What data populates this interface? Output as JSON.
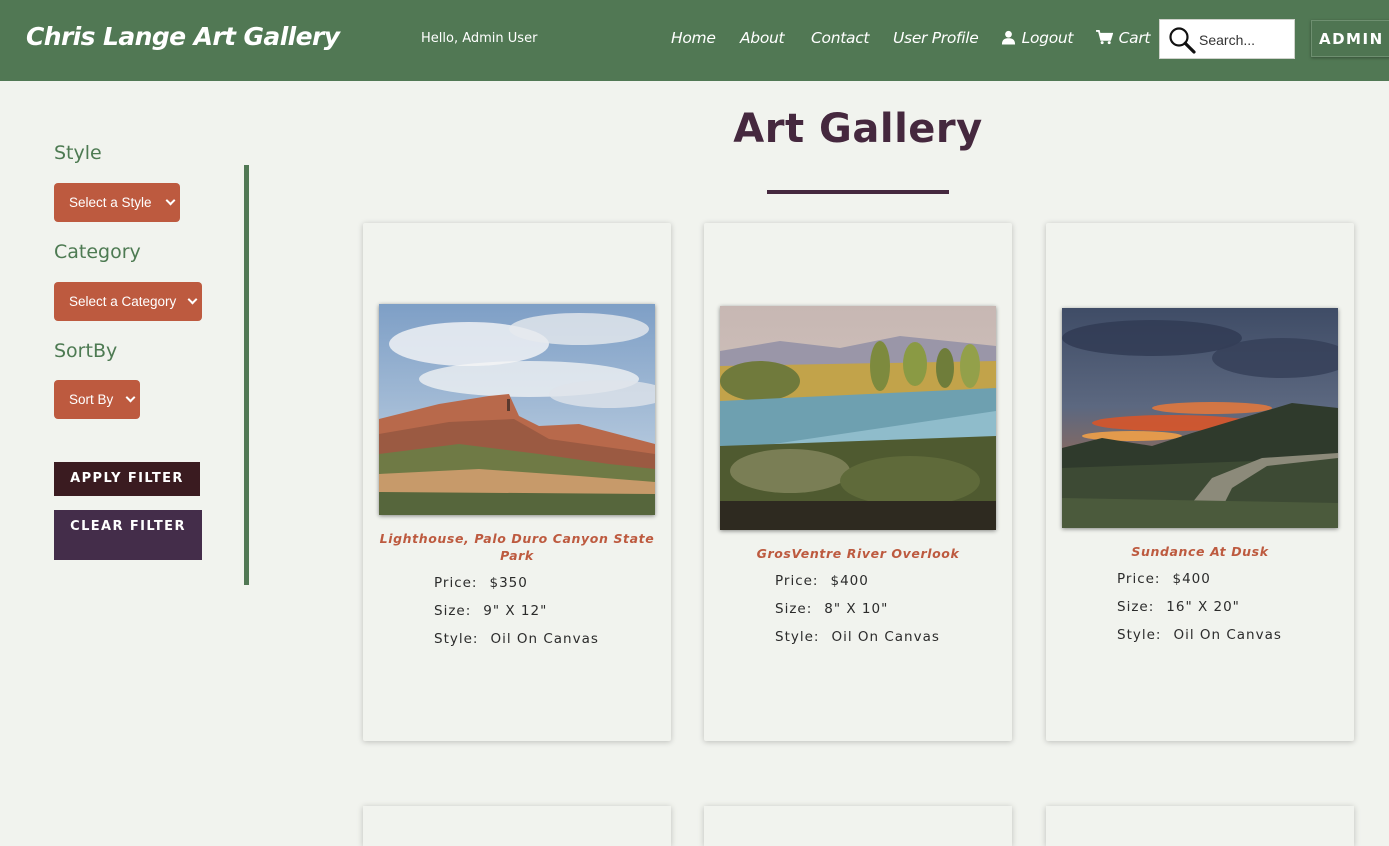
{
  "header": {
    "brand": "Chris Lange Art Gallery",
    "greeting": "Hello, Admin User",
    "nav": {
      "home": "Home",
      "about": "About",
      "contact": "Contact",
      "user_profile": "User Profile",
      "logout": "Logout",
      "cart": "Cart"
    },
    "search_placeholder": "Search...",
    "admin_label": "ADMIN",
    "bg_color": "#517854"
  },
  "sidebar": {
    "style_heading": "Style",
    "style_select": "Select a Style",
    "category_heading": "Category",
    "category_select": "Select a Category",
    "sort_heading": "SortBy",
    "sort_select": "Sort By",
    "apply_label": "APPLY FILTER",
    "clear_label": "CLEAR FILTER"
  },
  "main": {
    "title": "Art Gallery",
    "labels": {
      "price": "Price:",
      "size": "Size:",
      "style": "Style:"
    },
    "artworks": [
      {
        "title": "Lighthouse, Palo Duro Canyon State Park",
        "price": "$350",
        "size": "9\" X 12\"",
        "style": "Oil On Canvas"
      },
      {
        "title": "GrosVentre River Overlook",
        "price": "$400",
        "size": "8\" X 10\"",
        "style": "Oil On Canvas"
      },
      {
        "title": "Sundance At Dusk",
        "price": "$400",
        "size": "16\" X 20\"",
        "style": "Oil On Canvas"
      }
    ]
  },
  "colors": {
    "accent": "#bd5a3f",
    "title": "#45283e",
    "apply": "#3a1b20",
    "clear": "#442d4a",
    "background": "#f1f3ee"
  }
}
